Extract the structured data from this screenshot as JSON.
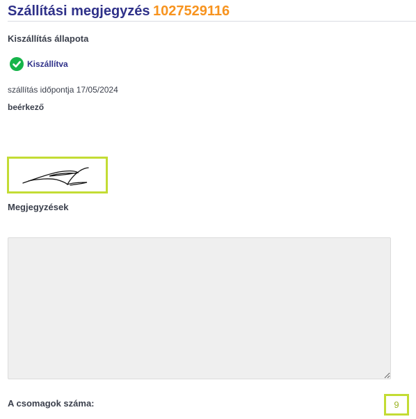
{
  "header": {
    "title": "Szállítási megjegyzés",
    "delivery_number": "1027529116"
  },
  "status": {
    "label": "Kiszállítás állapota",
    "value": "Kiszállítva",
    "icon": "check-circle-icon",
    "color": "#16b44a"
  },
  "delivery": {
    "time_text": "szállítás időpontja 17/05/2024",
    "receiver": "beérkező"
  },
  "signature": {
    "icon": "signature-image"
  },
  "notes": {
    "label": "Megjegyzések",
    "value": ""
  },
  "packages": {
    "label": "A csomagok száma:",
    "count": "9"
  },
  "colors": {
    "title": "#2f3189",
    "number": "#f7931e",
    "highlight": "#c3dc34"
  }
}
